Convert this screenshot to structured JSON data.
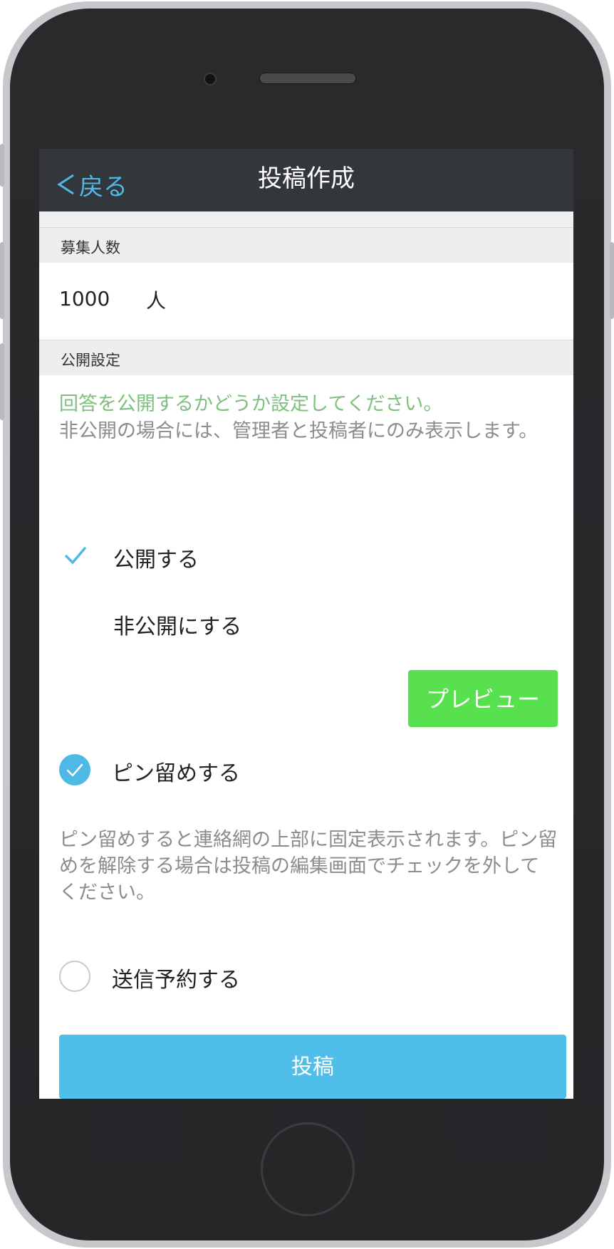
{
  "navbar": {
    "back_label": "戻る",
    "title": "投稿作成"
  },
  "recruit": {
    "header": "募集人数",
    "value": "1000",
    "unit": "人"
  },
  "visibility": {
    "header": "公開設定",
    "desc_green": "回答を公開するかどうか設定してください。",
    "desc_gray": "非公開の場合には、管理者と投稿者にのみ表示します。",
    "options": [
      {
        "label": "公開する",
        "selected": true
      },
      {
        "label": "非公開にする",
        "selected": false
      }
    ]
  },
  "preview_label": "プレビュー",
  "pin": {
    "label": "ピン留めする",
    "checked": true,
    "desc": "ピン留めすると連絡網の上部に固定表示されます。ピン留めを解除する場合は投稿の編集画面でチェックを外してください。"
  },
  "schedule": {
    "label": "送信予約する",
    "checked": false
  },
  "submit_label": "投稿",
  "colors": {
    "accent": "#4fb9e5",
    "preview": "#58e04f",
    "navbar": "#33373b",
    "hint_green": "#7fbf7f"
  }
}
